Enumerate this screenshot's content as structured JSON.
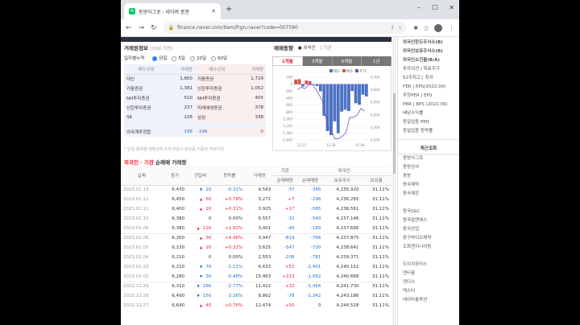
{
  "browser": {
    "tab_title": "동방아그로 : 네이버 증권",
    "url": "finance.naver.com/item/frgn.naver?code=007590"
  },
  "main": {
    "trading_title": "거래원정보",
    "trading_sub": "(20분 지연)",
    "cumulative_label": "일자별누적",
    "radios": [
      "당일",
      "5일",
      "20일",
      "60일"
    ],
    "table_headers": [
      "매도상위",
      "거래량",
      "매수상위",
      "거래량"
    ],
    "rows": [
      {
        "sell": "대신",
        "sv": "1,800",
        "buy": "키움증권",
        "bv": "1,729"
      },
      {
        "sell": "키움증권",
        "sv": "1,381",
        "buy": "신한투자증권",
        "bv": "1,052"
      },
      {
        "sell": "NH투자증권",
        "sv": "510",
        "buy": "NH투자증권",
        "bv": "405"
      },
      {
        "sell": "신한투자증권",
        "sv": "237",
        "buy": "미래에셋증권",
        "bv": "378"
      },
      {
        "sell": "SK",
        "sv": "226",
        "buy": "삼성",
        "bv": "338"
      }
    ],
    "foreign_label": "외국계추정합",
    "foreign_sell": "196",
    "foreign_net": "-196",
    "foreign_buy": "0",
    "note": "* 당일 종목별 매매상위 5개 회원사 정보를 이용한 추정치임",
    "chart_title": "매매동향",
    "chart_radio1": "외국인",
    "chart_radio2": "기관",
    "periods": [
      "1개월",
      "3개월",
      "6개월",
      "1년"
    ],
    "legend": [
      "매도",
      "매수",
      "주가"
    ],
    "section2_title_a": "외국인 · 기관",
    "section2_title_b": " 순매매 거래량",
    "t2_headers_top": [
      "날짜",
      "종가",
      "전일비",
      "등락률",
      "거래량",
      "기관",
      "외국인"
    ],
    "t2_headers_sub": [
      "순매매량",
      "순매매량",
      "보유주수",
      "보유율"
    ],
    "t2_rows": [
      {
        "date": "2023.01.13",
        "close": "6,430",
        "dir": "▼",
        "chg": "20",
        "pct": "-0.31%",
        "vol": "4,543",
        "inst": "-37",
        "frgn": "-345",
        "hold": "4,235,920",
        "ratio": "31.11%"
      },
      {
        "date": "2023.01.12",
        "close": "6,450",
        "dir": "▲",
        "chg": "50",
        "pct": "+0.78%",
        "vol": "3,271",
        "inst": "+7",
        "frgn": "-296",
        "hold": "4,236,265",
        "ratio": "31.11%"
      },
      {
        "date": "2023.01.11",
        "close": "6,400",
        "dir": "▲",
        "chg": "20",
        "pct": "+0.31%",
        "vol": "3,925",
        "inst": "+17",
        "frgn": "-585",
        "hold": "4,236,561",
        "ratio": "31.11%"
      },
      {
        "date": "2023.01.10",
        "close": "6,380",
        "dir": "",
        "chg": "0",
        "pct": "0.00%",
        "vol": "6,557",
        "inst": "-32",
        "frgn": "-540",
        "hold": "4,237,146",
        "ratio": "31.11%"
      },
      {
        "date": "2023.01.09",
        "close": "6,380",
        "dir": "▲",
        "chg": "120",
        "pct": "+1.92%",
        "vol": "3,401",
        "inst": "-40",
        "frgn": "-189",
        "hold": "4,237,686",
        "ratio": "31.11%"
      },
      {
        "date": "2023.01.06",
        "close": "6,260",
        "dir": "▲",
        "chg": "30",
        "pct": "+0.48%",
        "vol": "3,947",
        "inst": "-814",
        "frgn": "-766",
        "hold": "4,237,875",
        "ratio": "31.11%"
      },
      {
        "date": "2023.01.05",
        "close": "6,230",
        "dir": "▲",
        "chg": "20",
        "pct": "+0.32%",
        "vol": "3,625",
        "inst": "-547",
        "frgn": "-730",
        "hold": "4,238,641",
        "ratio": "31.11%"
      },
      {
        "date": "2023.01.04",
        "close": "6,210",
        "dir": "",
        "chg": "0",
        "pct": "0.00%",
        "vol": "2,553",
        "inst": "-208",
        "frgn": "-781",
        "hold": "4,239,371",
        "ratio": "31.11%"
      },
      {
        "date": "2023.01.03",
        "close": "6,210",
        "dir": "▼",
        "chg": "70",
        "pct": "-1.11%",
        "vol": "6,633",
        "inst": "+52",
        "frgn": "-1,401",
        "hold": "4,240,152",
        "ratio": "31.11%"
      },
      {
        "date": "2023.01.02",
        "close": "6,280",
        "dir": "▼",
        "chg": "30",
        "pct": "-0.48%",
        "vol": "15,463",
        "inst": "+213",
        "frgn": "-1,062",
        "hold": "4,240,668",
        "ratio": "31.11%"
      },
      {
        "date": "2022.12.29",
        "close": "6,310",
        "dir": "▼",
        "chg": "180",
        "pct": "-2.77%",
        "vol": "11,412",
        "inst": "+32",
        "frgn": "-1,456",
        "hold": "4,241,730",
        "ratio": "31.11%"
      },
      {
        "date": "2022.12.28",
        "close": "6,490",
        "dir": "▼",
        "chg": "150",
        "pct": "-2.26%",
        "vol": "8,862",
        "inst": "-78",
        "frgn": "-1,342",
        "hold": "4,243,186",
        "ratio": "31.11%"
      },
      {
        "date": "2022.12.27",
        "close": "6,640",
        "dir": "▲",
        "chg": "40",
        "pct": "+0.76%",
        "vol": "12,474",
        "inst": "+50",
        "frgn": "0",
        "hold": "4,244,528",
        "ratio": "31.11%"
      }
    ]
  },
  "side": {
    "top_items": [
      "외국인한도주식수(B)",
      "외국인보유주식수(B)",
      "외국인소진율(B/A)",
      "투자의견 | 목표주가",
      "52주최고 | 최저",
      "PER | EPS(2022.09)",
      "추정PER | EPS",
      "PBR | BPS (2022.09)",
      "배당수익률",
      "동일업종 PER",
      "동일업종 등락률"
    ],
    "recent_title": "최근조회",
    "recent_items": [
      "동방아그로",
      "동방상사",
      "동방",
      "동국제약",
      "동국제강",
      "",
      "동국S&C",
      "동국알앤에스",
      "동국산업",
      "동구바이오제약",
      "도화엔지니어링",
      "",
      "도이치모터스",
      "덴티움",
      "덴티스",
      "덱스터",
      "데이타솔루션"
    ]
  },
  "chart_data": {
    "type": "bar",
    "title": "매매동향",
    "x_ticks": [
      "12.21",
      "12.28",
      "01.06"
    ],
    "y_left_ticks": [
      "200",
      "0",
      "-200",
      "-400",
      "-600",
      "-800",
      "-1,000",
      "-1,200",
      "-1,400",
      "-1,600"
    ],
    "y_right_ticks": [
      "6,700",
      "6,600",
      "6,500",
      "6,400",
      "6,300",
      "6,200"
    ],
    "values": [
      130,
      140,
      -60,
      100,
      80,
      -10,
      -50,
      -200,
      -900,
      -1342,
      -1456,
      -1062,
      -1401,
      -781,
      -730,
      -766,
      -189,
      -540,
      -585,
      -296,
      -345
    ],
    "price_line": [
      6600,
      6620,
      6610,
      6640,
      6640,
      6600,
      6550,
      6490,
      6310,
      6280,
      6210,
      6210,
      6230,
      6260,
      6380,
      6380,
      6400,
      6450,
      6430
    ],
    "colors": {
      "sell": "#4a74c9",
      "buy": "#d9534f",
      "price": "#7a4fbf"
    }
  }
}
